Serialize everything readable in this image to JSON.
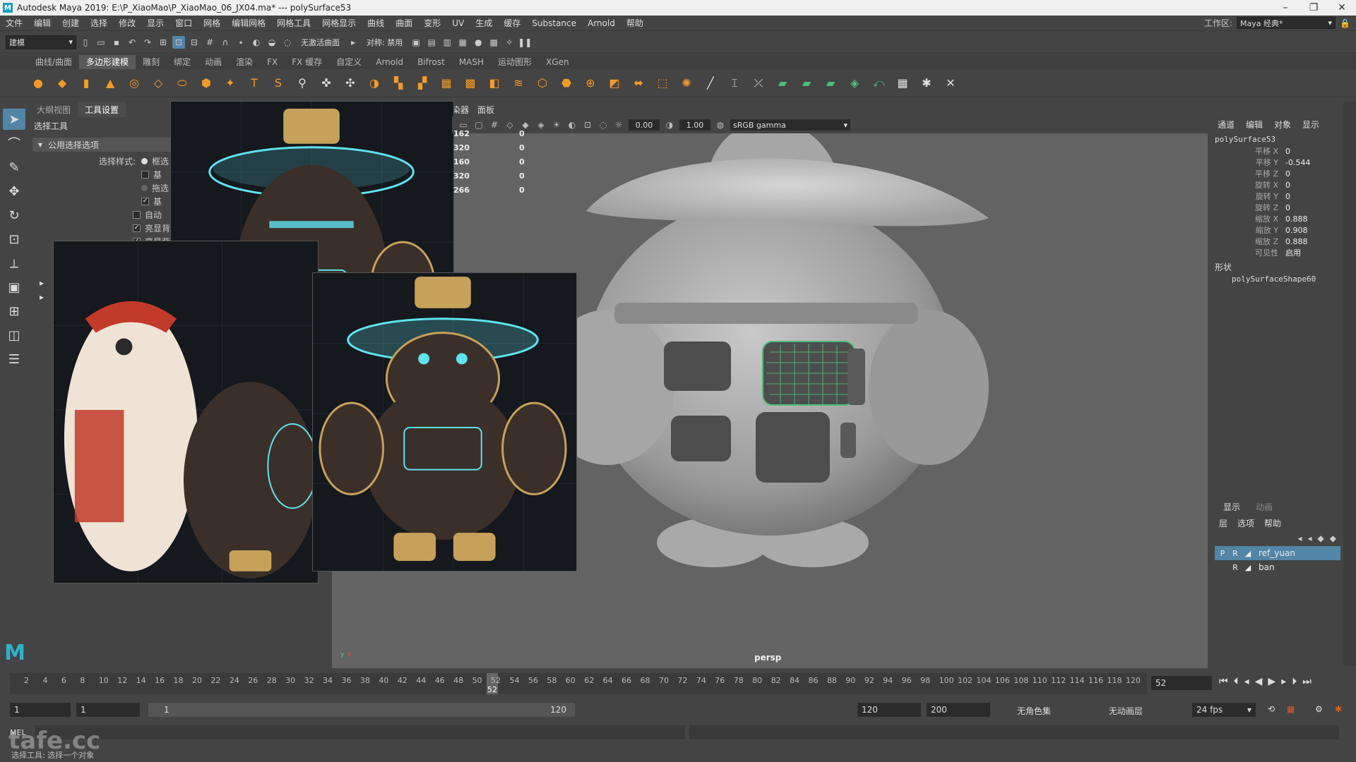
{
  "window": {
    "title": "Autodesk Maya 2019: E:\\P_XiaoMao\\P_XiaoMao_06_JX04.ma*   ---   polySurface53"
  },
  "menubar": {
    "items": [
      "文件",
      "编辑",
      "创建",
      "选择",
      "修改",
      "显示",
      "窗口",
      "网格",
      "编辑网格",
      "网格工具",
      "网格显示",
      "曲线",
      "曲面",
      "变形",
      "UV",
      "生成",
      "缓存",
      "Substance",
      "Arnold",
      "帮助"
    ],
    "workspace_label": "工作区:",
    "workspace_value": "Maya 经典*"
  },
  "statusline": {
    "mode": "建模",
    "live_surface": "无激活曲面",
    "symmetry": "对称: 禁用"
  },
  "shelf": {
    "tabs": [
      "曲线/曲面",
      "多边形建模",
      "雕刻",
      "绑定",
      "动画",
      "渲染",
      "FX",
      "FX 缓存",
      "自定义",
      "Arnold",
      "Bifrost",
      "MASH",
      "运动图形",
      "XGen"
    ],
    "active_tab": "多边形建模"
  },
  "attribute_editor": {
    "tabs": [
      "大纲视图",
      "工具设置"
    ],
    "active_tab": "工具设置",
    "title": "选择工具",
    "section": "公用选择选项",
    "select_style_label": "选择样式:",
    "options": [
      "框选",
      "基",
      "拖选",
      "基",
      "自动",
      "亮显背",
      "亮显背"
    ]
  },
  "panel_menu": [
    "染器",
    "面板"
  ],
  "viewport": {
    "exposure": "0.00",
    "gamma": "1.00",
    "color_space": "sRGB gamma",
    "camera": "persp",
    "hud_rows": [
      {
        "a": "162",
        "b": "0"
      },
      {
        "a": "320",
        "b": "0"
      },
      {
        "a": "160",
        "b": "0"
      },
      {
        "a": "320",
        "b": "0"
      },
      {
        "a": "266",
        "b": "0"
      }
    ]
  },
  "channel_box": {
    "menus": [
      "通道",
      "编辑",
      "对象",
      "显示"
    ],
    "object": "polySurface53",
    "channels": [
      {
        "label": "平移 X",
        "value": "0"
      },
      {
        "label": "平移 Y",
        "value": "-0.544"
      },
      {
        "label": "平移 Z",
        "value": "0"
      },
      {
        "label": "旋转 X",
        "value": "0"
      },
      {
        "label": "旋转 Y",
        "value": "0"
      },
      {
        "label": "旋转 Z",
        "value": "0"
      },
      {
        "label": "缩放 X",
        "value": "0.888"
      },
      {
        "label": "缩放 Y",
        "value": "0.908"
      },
      {
        "label": "缩放 Z",
        "value": "0.888"
      },
      {
        "label": "可见性",
        "value": "启用"
      }
    ],
    "shapes_label": "形状",
    "shape": "polySurfaceShape60"
  },
  "layer_editor": {
    "tabs": [
      "显示",
      "动画"
    ],
    "menus": [
      "层",
      "选项",
      "帮助"
    ],
    "layers": [
      {
        "flag1": "P",
        "flag2": "R",
        "name": "ref_yuan",
        "selected": true
      },
      {
        "flag1": "",
        "flag2": "R",
        "name": "ban",
        "selected": false
      }
    ]
  },
  "timeline": {
    "ticks": [
      "2",
      "4",
      "6",
      "8",
      "10",
      "12",
      "14",
      "16",
      "18",
      "20",
      "22",
      "24",
      "26",
      "28",
      "30",
      "32",
      "34",
      "36",
      "38",
      "40",
      "42",
      "44",
      "46",
      "48",
      "50",
      "52",
      "54",
      "56",
      "58",
      "60",
      "62",
      "64",
      "66",
      "68",
      "70",
      "72",
      "74",
      "76",
      "78",
      "80",
      "82",
      "84",
      "86",
      "88",
      "90",
      "92",
      "94",
      "96",
      "98",
      "100",
      "102",
      "104",
      "106",
      "108",
      "110",
      "112",
      "114",
      "116",
      "118",
      "120"
    ],
    "current_frame": "52"
  },
  "range": {
    "start": "1",
    "playback_start": "1",
    "slider_start": "1",
    "slider_end": "120",
    "playback_end": "120",
    "end": "200",
    "character_set": "无角色集",
    "anim_layer": "无动画层",
    "fps": "24 fps"
  },
  "command_line": {
    "mel_label": "MEL"
  },
  "help_line": "选择工具: 选择一个对象",
  "watermark": "tafe.cc"
}
